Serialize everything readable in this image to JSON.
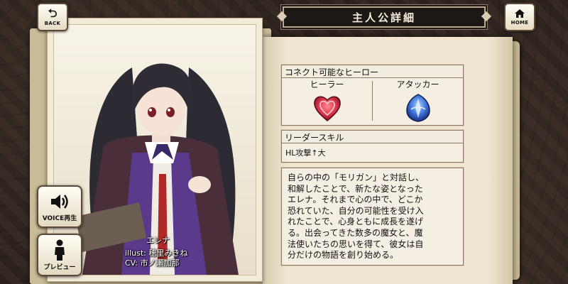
{
  "header": {
    "back_label": "BACK",
    "home_label": "HOME",
    "title": "主人公詳細"
  },
  "character": {
    "name": "エレナ",
    "illust": "illust: 穂里みきね",
    "cv": "CV: 市ノ瀬加那"
  },
  "buttons": {
    "voice_label": "VOICE再生",
    "preview_label": "プレビュー"
  },
  "heroes_panel": {
    "header": "コネクト可能なヒーロー",
    "heroes": [
      {
        "name": "ヒーラー",
        "icon": "healer-heart-icon",
        "color": "#d8344a"
      },
      {
        "name": "アタッカー",
        "icon": "attacker-blade-icon",
        "color": "#3b6fd8"
      }
    ]
  },
  "leader_panel": {
    "header": "リーダースキル",
    "skill": "HL攻撃↑大"
  },
  "description": "自らの中の「モリガン」と対話し、\n和解したことで、新たな姿となった\nエレナ。それまで心の中で、どこか\n恐れていた、自分の可能性を受け入\nれたことで、心身ともに成長を遂げ\nる。出会ってきた数多の魔女と、魔\n法使いたちの思いを得て、彼女は自\n分だけの物語を創り始める。"
}
